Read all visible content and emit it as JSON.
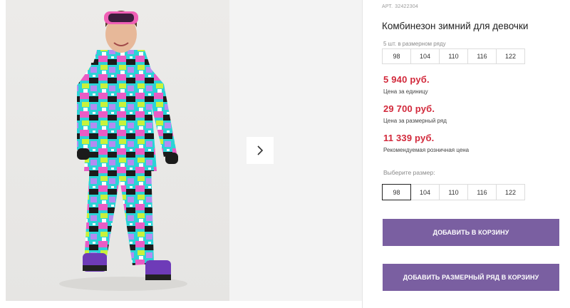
{
  "product": {
    "sku_label": "АРТ.",
    "sku": "32422304",
    "title": "Комбинезон зимний для девочки",
    "image_alt": "photo-product-girl-winter-suit"
  },
  "pack": {
    "note": "5 шт. в размерном ряду",
    "sizes": [
      "98",
      "104",
      "110",
      "116",
      "122"
    ]
  },
  "prices": {
    "unit": "5 940 руб.",
    "unit_label": "Цена за единицу",
    "pack": "29 700 руб.",
    "pack_label": "Цена за размерный ряд",
    "retail": "11 339 руб.",
    "retail_label": "Рекомендуемая розничная цена"
  },
  "size_select": {
    "label": "Выберите размер:",
    "sizes": [
      "98",
      "104",
      "110",
      "116",
      "122"
    ],
    "selected": "98"
  },
  "buttons": {
    "add_to_cart": "ДОБАВИТЬ В КОРЗИНУ",
    "add_pack_to_cart": "ДОБАВИТЬ РАЗМЕРНЫЙ РЯД В КОРЗИНУ"
  },
  "colors": {
    "price_red": "#d2293b",
    "button_purple": "#7a5fa1"
  },
  "icons": {
    "next": "chevron-right-icon"
  }
}
